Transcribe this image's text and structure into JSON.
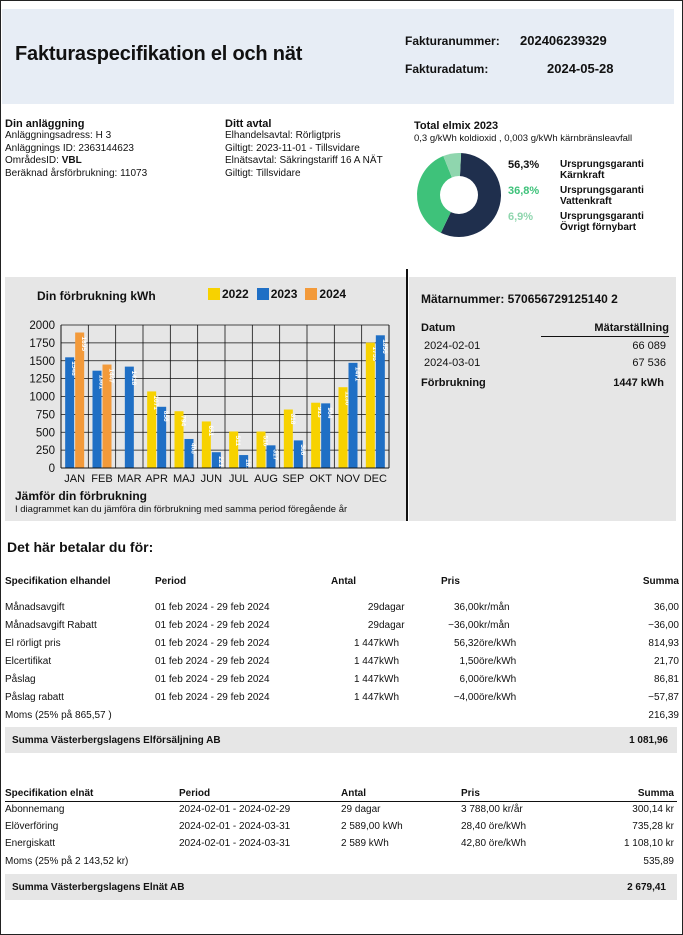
{
  "header": {
    "title": "Fakturaspecifikation el och nät",
    "invoice_number_label": "Fakturanummer:",
    "invoice_number": "202406239329",
    "invoice_date_label": "Fakturadatum:",
    "invoice_date": "2024-05-28"
  },
  "facility": {
    "title": "Din anläggning",
    "address": "Anläggningsadress: H 3",
    "id": "Anläggnings ID:  2363144623",
    "area_label": "OmrådesID: ",
    "area": "VBL",
    "annual": "Beräknad årsförbrukning:  11073"
  },
  "contract": {
    "title": "Ditt avtal",
    "line1": "Elhandelsavtal: Rörligtpris",
    "line2": "Giltigt: 2023-11-01 - Tillsvidare",
    "line3": "Elnätsavtal: Säkringstariff 16 A NÄT",
    "line4": "Giltigt: Tillsvidare"
  },
  "mix": {
    "title": "Total elmix 2023",
    "subtitle": "0,3 g/kWh koldioxid , 0,003 g/kWh kärnbränsleavfall",
    "items": [
      {
        "pct": "56,3%",
        "label1": "Ursprungsgaranti",
        "label2": "Kärnkraft",
        "color": "#1f2f4d",
        "pct_color": "#111111",
        "value": 56.3
      },
      {
        "pct": "36,8%",
        "label1": "Ursprungsgaranti",
        "label2": "Vattenkraft",
        "color": "#3ec27a",
        "pct_color": "#3ec27a",
        "value": 36.8
      },
      {
        "pct": "6,9%",
        "label1": "Ursprungsgaranti",
        "label2": "Övrigt förnybart",
        "color": "#8fd6ae",
        "pct_color": "#8fd6ae",
        "value": 6.9
      }
    ]
  },
  "chart_data": {
    "type": "bar",
    "title": "Din förbrukning kWh",
    "categories": [
      "JAN",
      "FEB",
      "MAR",
      "APR",
      "MAJ",
      "JUN",
      "JUL",
      "AUG",
      "SEP",
      "OKT",
      "NOV",
      "DEC"
    ],
    "ylim": [
      0,
      2000
    ],
    "yticks": [
      "0",
      "250",
      "500",
      "750",
      "1000",
      "1250",
      "1500",
      "1750",
      "2000"
    ],
    "legend_position": "top",
    "series": [
      {
        "name": "2022",
        "color": "#f7d200",
        "values": [
          null,
          null,
          null,
          1071,
          794,
          651,
          511,
          510,
          818,
          913,
          1130,
          1753
        ]
      },
      {
        "name": "2023",
        "color": "#1f6fc5",
        "values": [
          1548,
          1361,
          1418,
          856,
          406,
          221,
          181,
          317,
          386,
          904,
          1471,
          1856
        ]
      },
      {
        "name": "2024",
        "color": "#f39a3a",
        "values": [
          1895,
          1447,
          null,
          null,
          null,
          null,
          null,
          null,
          null,
          null,
          null,
          null
        ]
      }
    ],
    "compare_title": "Jämför din förbrukning",
    "compare_text": "I diagrammet kan du jämföra din förbrukning med samma period föregående år"
  },
  "meter": {
    "title": "Mätarnummer: 570656729125140 2",
    "date_header": "Datum",
    "reading_header": "Mätarställning",
    "rows": [
      {
        "date": "2024-02-01",
        "value": "66 089"
      },
      {
        "date": "2024-03-01",
        "value": "67 536"
      }
    ],
    "usage_label": "Förbrukning",
    "usage_value": "1447 kWh"
  },
  "pay_title": "Det här betalar du för:",
  "elhandel": {
    "headers": [
      "Specifikation elhandel",
      "Period",
      "Antal",
      "Pris",
      "Summa"
    ],
    "rows": [
      [
        "Månadsavgift",
        "01 feb 2024 - 29 feb 2024",
        "29",
        "dagar",
        "36,00",
        "kr/mån",
        "36,00"
      ],
      [
        "Månadsavgift Rabatt",
        "01 feb 2024 - 29 feb 2024",
        "29",
        "dagar",
        "−36,00",
        "kr/mån",
        "−36,00"
      ],
      [
        "El rörligt pris",
        "01 feb 2024 - 29 feb 2024",
        "1 447",
        "kWh",
        "56,32",
        "öre/kWh",
        "814,93"
      ],
      [
        "Elcertifikat",
        "01 feb 2024 - 29 feb 2024",
        "1 447",
        "kWh",
        "1,50",
        "öre/kWh",
        "21,70"
      ],
      [
        "Påslag",
        "01 feb 2024 - 29 feb 2024",
        "1 447",
        "kWh",
        "6,00",
        "öre/kWh",
        "86,81"
      ],
      [
        "Påslag rabatt",
        "01 feb 2024 - 29 feb 2024",
        "1 447",
        "kWh",
        "−4,00",
        "öre/kWh",
        "−57,87"
      ]
    ],
    "vat_label": "Moms (25% på 865,57 )",
    "vat_value": "216,39",
    "sum_label": "Summa Västerbergslagens Elförsäljning AB",
    "sum_value": "1 081,96"
  },
  "elnat": {
    "headers": [
      "Specifikation elnät",
      "Period",
      "Antal",
      "Pris",
      "Summa"
    ],
    "rows": [
      [
        "Abonnemang",
        "2024-02-01 - 2024-02-29",
        "29 dagar",
        "3 788,00 kr/år",
        "300,14 kr"
      ],
      [
        "Elöverföring",
        "2024-02-01 - 2024-03-31",
        "2 589,00 kWh",
        "28,40 öre/kWh",
        "735,28 kr"
      ],
      [
        "Energiskatt",
        "2024-02-01 - 2024-03-31",
        "2 589 kWh",
        "42,80 öre/kWh",
        "1 108,10 kr"
      ]
    ],
    "vat_label": "Moms (25% på 2 143,52 kr)",
    "vat_value": "535,89",
    "sum_label": "Summa Västerbergslagens Elnät AB",
    "sum_value": "2 679,41"
  }
}
